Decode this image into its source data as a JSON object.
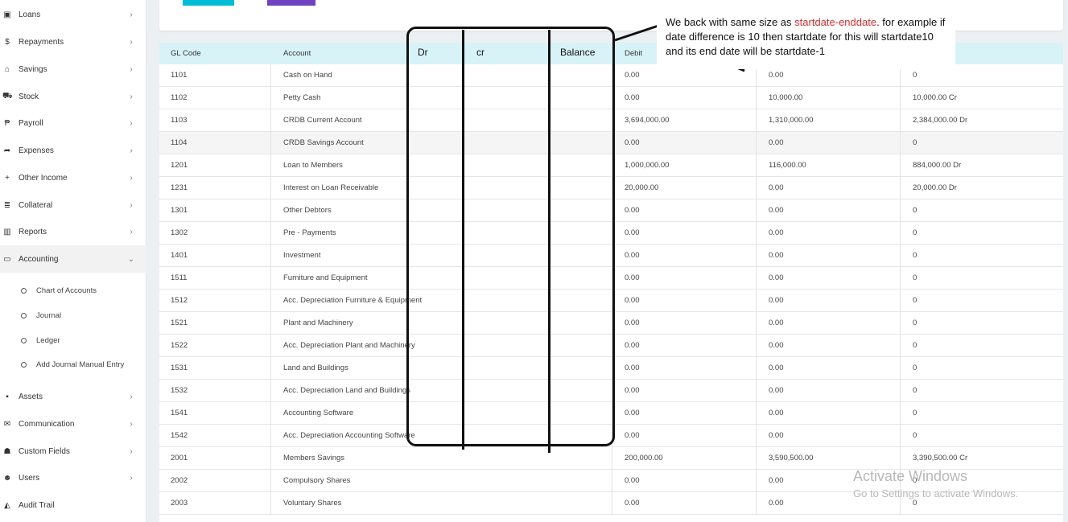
{
  "sidebar": {
    "items": [
      {
        "icon": "▣",
        "label": "Loans"
      },
      {
        "icon": "$",
        "label": "Repayments"
      },
      {
        "icon": "⌂",
        "label": "Savings"
      },
      {
        "icon": "⛟",
        "label": "Stock"
      },
      {
        "icon": "₱",
        "label": "Payroll"
      },
      {
        "icon": "➦",
        "label": "Expenses"
      },
      {
        "icon": "+",
        "label": "Other Income"
      },
      {
        "icon": "≣",
        "label": "Collateral"
      },
      {
        "icon": "▥",
        "label": "Reports"
      },
      {
        "icon": "▭",
        "label": "Accounting"
      }
    ],
    "accounting_sub": [
      {
        "label": "Chart of Accounts"
      },
      {
        "label": "Journal"
      },
      {
        "label": "Ledger"
      },
      {
        "label": "Add Journal Manual Entry"
      }
    ],
    "items_after": [
      {
        "icon": "▪",
        "label": "Assets"
      },
      {
        "icon": "✉",
        "label": "Communication"
      },
      {
        "icon": "☗",
        "label": "Custom Fields"
      },
      {
        "icon": "☻",
        "label": "Users"
      },
      {
        "icon": "◭",
        "label": "Audit Trail"
      }
    ],
    "chevron_right": "›",
    "chevron_down": "⌄"
  },
  "table": {
    "headers": {
      "gl_code": "GL Code",
      "account": "Account",
      "debit": "Debit"
    },
    "rows": [
      {
        "code": "1101",
        "account": "Cash on Hand",
        "debit": "0.00",
        "credit": "0.00",
        "balance": "0"
      },
      {
        "code": "1102",
        "account": "Petty Cash",
        "debit": "0.00",
        "credit": "10,000.00",
        "balance": "10,000.00 Cr"
      },
      {
        "code": "1103",
        "account": "CRDB Current Account",
        "debit": "3,694,000.00",
        "credit": "1,310,000.00",
        "balance": "2,384,000.00 Dr"
      },
      {
        "code": "1104",
        "account": "CRDB Savings Account",
        "debit": "0.00",
        "credit": "0.00",
        "balance": "0"
      },
      {
        "code": "1201",
        "account": "Loan to Members",
        "debit": "1,000,000.00",
        "credit": "116,000.00",
        "balance": "884,000.00 Dr"
      },
      {
        "code": "1231",
        "account": "Interest on Loan Receivable",
        "debit": "20,000.00",
        "credit": "0.00",
        "balance": "20,000.00 Dr"
      },
      {
        "code": "1301",
        "account": "Other Debtors",
        "debit": "0.00",
        "credit": "0.00",
        "balance": "0"
      },
      {
        "code": "1302",
        "account": "Pre - Payments",
        "debit": "0.00",
        "credit": "0.00",
        "balance": "0"
      },
      {
        "code": "1401",
        "account": "Investment",
        "debit": "0.00",
        "credit": "0.00",
        "balance": "0"
      },
      {
        "code": "1511",
        "account": "Furniture and Equipment",
        "debit": "0.00",
        "credit": "0.00",
        "balance": "0"
      },
      {
        "code": "1512",
        "account": "Acc. Depreciation Furniture & Equipment",
        "debit": "0.00",
        "credit": "0.00",
        "balance": "0"
      },
      {
        "code": "1521",
        "account": "Plant and Machinery",
        "debit": "0.00",
        "credit": "0.00",
        "balance": "0"
      },
      {
        "code": "1522",
        "account": "Acc. Depreciation Plant and Machinery",
        "debit": "0.00",
        "credit": "0.00",
        "balance": "0"
      },
      {
        "code": "1531",
        "account": "Land and Buildings",
        "debit": "0.00",
        "credit": "0.00",
        "balance": "0"
      },
      {
        "code": "1532",
        "account": "Acc. Depreciation Land and Buildings",
        "debit": "0.00",
        "credit": "0.00",
        "balance": "0"
      },
      {
        "code": "1541",
        "account": "Accounting Software",
        "debit": "0.00",
        "credit": "0.00",
        "balance": "0"
      },
      {
        "code": "1542",
        "account": "Acc. Depreciation Accounting Software",
        "debit": "0.00",
        "credit": "0.00",
        "balance": "0"
      },
      {
        "code": "2001",
        "account": "Members Savings",
        "debit": "200,000.00",
        "credit": "3,590,500.00",
        "balance": "3,390,500.00 Cr"
      },
      {
        "code": "2002",
        "account": "Compulsory Shares",
        "debit": "0.00",
        "credit": "0.00",
        "balance": "0"
      },
      {
        "code": "2003",
        "account": "Voluntary Shares",
        "debit": "0.00",
        "credit": "0.00",
        "balance": "0"
      }
    ]
  },
  "annotation": {
    "col_dr": "Dr",
    "col_cr": "cr",
    "col_balance": "Balance",
    "callout_part1": "We back with same size as ",
    "callout_highlight": "startdate-enddate",
    "callout_part2": ". for example if date difference is 10 then startdate for this will startdate10 and its end date will be startdate-1"
  },
  "watermark": {
    "line1": "Activate Windows",
    "line2": "Go to Settings to activate Windows."
  },
  "colors": {
    "header_bg": "#d7f3f8",
    "btn_teal": "#00bcd4",
    "btn_purple": "#6f42c1",
    "highlight_red": "#d32f2f"
  }
}
